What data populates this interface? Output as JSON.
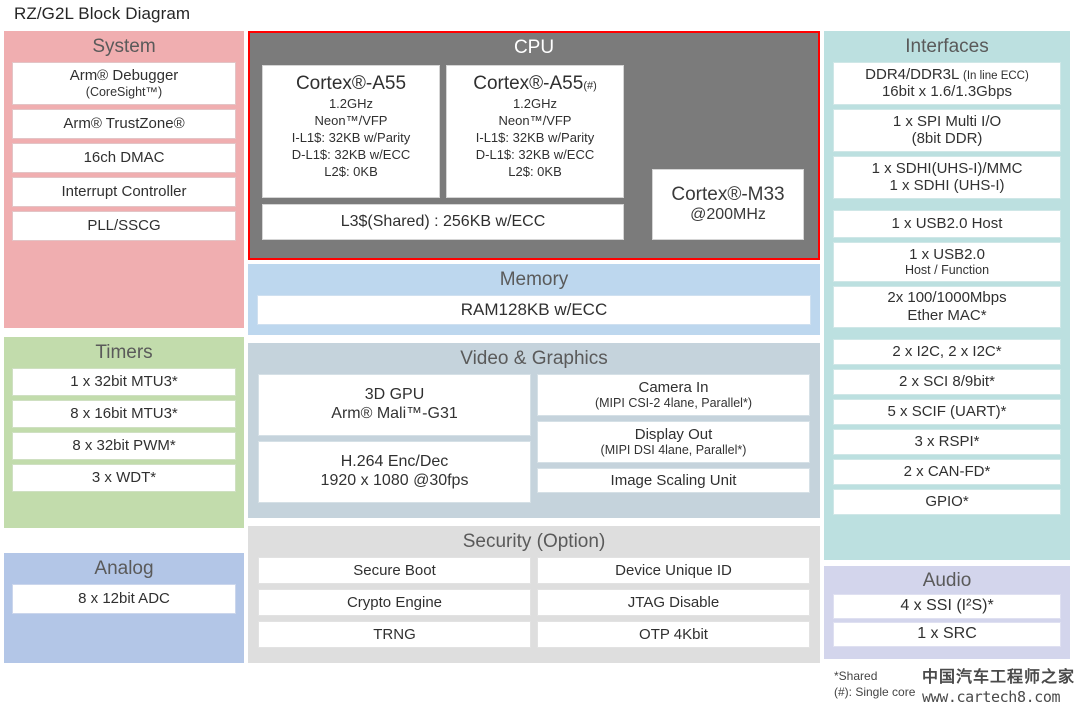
{
  "page": {
    "title": "RZ/G2L Block Diagram"
  },
  "colors": {
    "system": "#F0AEB0",
    "timers": "#C2DCAC",
    "analog": "#B3C6E7",
    "cpu": "#7B7B7B",
    "cpu_border": "#FF0000",
    "memory": "#BDD7EE",
    "video": "#C5D3DC",
    "security": "#DEDEDE",
    "interfaces": "#BCE0E0",
    "audio": "#D3D5EC",
    "cell": "#FFFFFF"
  },
  "system": {
    "title": "System",
    "items": [
      {
        "main": "Arm® Debugger",
        "sub": "(CoreSight™)"
      },
      {
        "main": "Arm® TrustZone®",
        "sub": ""
      },
      {
        "main": "16ch DMAC",
        "sub": ""
      },
      {
        "main": "Interrupt Controller",
        "sub": ""
      },
      {
        "main": "PLL/SSCG",
        "sub": ""
      }
    ]
  },
  "timers": {
    "title": "Timers",
    "items": [
      {
        "main": "1 x 32bit MTU3*"
      },
      {
        "main": "8 x 16bit MTU3*"
      },
      {
        "main": "8 x 32bit PWM*"
      },
      {
        "main": "3 x WDT*"
      }
    ]
  },
  "analog": {
    "title": "Analog",
    "items": [
      {
        "main": "8 x 12bit ADC"
      }
    ]
  },
  "cpu": {
    "title": "CPU",
    "cores": [
      {
        "name": "Cortex®-A55",
        "suffix": "",
        "specs": [
          "1.2GHz",
          "Neon™/VFP",
          "I-L1$: 32KB w/Parity",
          "D-L1$: 32KB w/ECC",
          "L2$: 0KB"
        ]
      },
      {
        "name": "Cortex®-A55",
        "suffix": "(#)",
        "specs": [
          "1.2GHz",
          "Neon™/VFP",
          "I-L1$: 32KB w/Parity",
          "D-L1$: 32KB w/ECC",
          "L2$: 0KB"
        ]
      }
    ],
    "l3": "L3$(Shared) : 256KB w/ECC",
    "m33": {
      "name": "Cortex®-M33",
      "clock": "@200MHz"
    }
  },
  "memory": {
    "title": "Memory",
    "items": [
      {
        "main": "RAM128KB  w/ECC"
      }
    ]
  },
  "video": {
    "title": "Video & Graphics",
    "left": [
      {
        "main": "3D GPU",
        "sub": "Arm® Mali™-G31",
        "big_sub": true
      },
      {
        "main": "H.264 Enc/Dec",
        "sub": "1920 x 1080 @30fps",
        "big_sub": true
      }
    ],
    "right": [
      {
        "main": "Camera In",
        "sub": "(MIPI CSI-2 4lane, Parallel*)"
      },
      {
        "main": "Display Out",
        "sub": "(MIPI DSI 4lane, Parallel*)"
      },
      {
        "main": "Image Scaling Unit",
        "sub": ""
      }
    ]
  },
  "security": {
    "title": "Security (Option)",
    "left": [
      {
        "main": "Secure Boot"
      },
      {
        "main": "Crypto Engine"
      },
      {
        "main": "TRNG"
      }
    ],
    "right": [
      {
        "main": "Device Unique ID"
      },
      {
        "main": "JTAG Disable"
      },
      {
        "main": "OTP 4Kbit"
      }
    ]
  },
  "interfaces": {
    "title": "Interfaces",
    "group1": [
      {
        "main": "DDR4/DDR3L",
        "main_small": "(In line ECC)",
        "sub": "16bit x 1.6/1.3Gbps",
        "inline": true
      },
      {
        "main": "1 x SPI Multi I/O",
        "sub": "(8bit DDR)"
      },
      {
        "main": "1 x SDHI(UHS-I)/MMC",
        "sub": "1 x SDHI (UHS-I)",
        "sub_big": true
      }
    ],
    "group2": [
      {
        "main": "1 x USB2.0 Host",
        "sub": ""
      },
      {
        "main": "1 x USB2.0",
        "sub": "Host / Function"
      },
      {
        "main": "2x 100/1000Mbps",
        "sub": "Ether MAC*",
        "sub_big": true
      }
    ],
    "group3": [
      {
        "main": "2 x I2C, 2 x I2C*"
      },
      {
        "main": "2 x SCI 8/9bit*"
      },
      {
        "main": "5 x SCIF (UART)*"
      },
      {
        "main": "3 x RSPI*"
      },
      {
        "main": "2 x CAN-FD*"
      },
      {
        "main": "GPIO*"
      }
    ]
  },
  "audio": {
    "title": "Audio",
    "items": [
      {
        "main": "4 x SSI (I²S)*"
      },
      {
        "main": "1 x SRC"
      }
    ]
  },
  "footnotes": [
    "*Shared",
    "(#): Single core"
  ],
  "watermark": {
    "cn": "中国汽车工程师之家",
    "url": "www.cartech8.com"
  }
}
